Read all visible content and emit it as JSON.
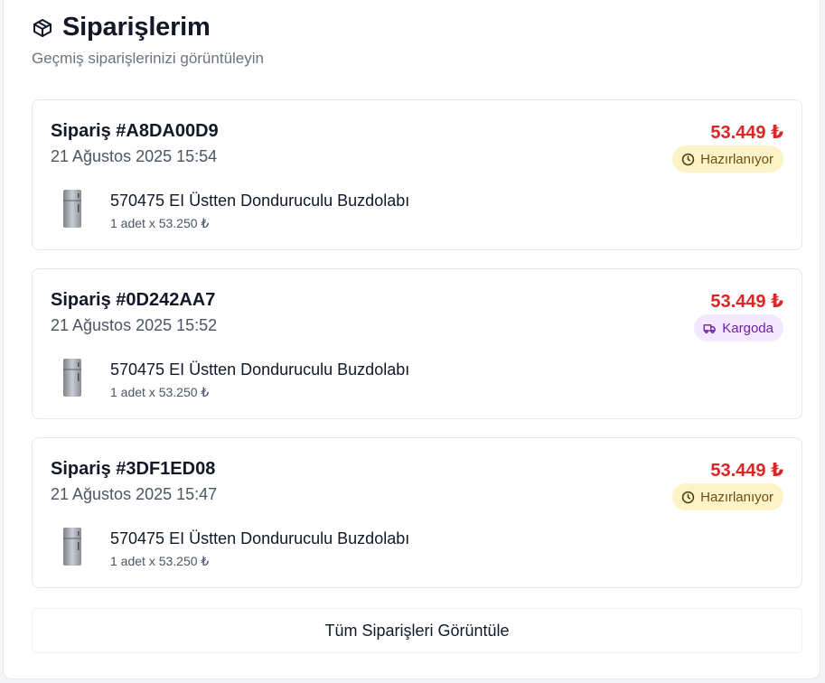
{
  "header": {
    "icon": "package-icon",
    "title": "Siparişlerim",
    "subtitle": "Geçmiş siparişlerinizi görüntüleyin"
  },
  "colors": {
    "price": "#dc2626",
    "badge_preparing_bg": "#fef3c7",
    "badge_preparing_text": "#6b4e16",
    "badge_shipping_bg": "#f3e8ff",
    "badge_shipping_text": "#6b21a8"
  },
  "orders": [
    {
      "id_label": "Sipariş #A8DA00D9",
      "date": "21 Ağustos 2025 15:54",
      "total": "53.449 ₺",
      "status": {
        "label": "Hazırlanıyor",
        "icon": "clock-icon",
        "type": "preparing"
      },
      "items": [
        {
          "name": "570475 EI Üstten Donduruculu Buzdolabı",
          "qty_price": "1 adet x 53.250 ₺",
          "image": "refrigerator-image"
        }
      ]
    },
    {
      "id_label": "Sipariş #0D242AA7",
      "date": "21 Ağustos 2025 15:52",
      "total": "53.449 ₺",
      "status": {
        "label": "Kargoda",
        "icon": "truck-icon",
        "type": "shipping"
      },
      "items": [
        {
          "name": "570475 EI Üstten Donduruculu Buzdolabı",
          "qty_price": "1 adet x 53.250 ₺",
          "image": "refrigerator-image"
        }
      ]
    },
    {
      "id_label": "Sipariş #3DF1ED08",
      "date": "21 Ağustos 2025 15:47",
      "total": "53.449 ₺",
      "status": {
        "label": "Hazırlanıyor",
        "icon": "clock-icon",
        "type": "preparing"
      },
      "items": [
        {
          "name": "570475 EI Üstten Donduruculu Buzdolabı",
          "qty_price": "1 adet x 53.250 ₺",
          "image": "refrigerator-image"
        }
      ]
    }
  ],
  "view_all_label": "Tüm Siparişleri Görüntüle"
}
